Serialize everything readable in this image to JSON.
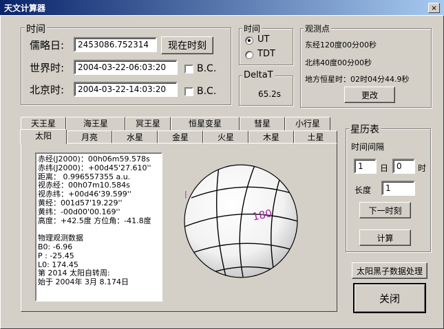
{
  "window": {
    "title": "天文计算器",
    "close_glyph": "×"
  },
  "time_group": {
    "legend": "时间",
    "jd_label": "儒略日:",
    "jd_value": "2453086.752314",
    "now_button": "现在时刻",
    "ut_label": "世界时:",
    "ut_value": "2004-03-22-06:03:20",
    "bj_label": "北京时:",
    "bj_value": "2004-03-22-14:03:20",
    "bc_label": "B.C."
  },
  "timescale_group": {
    "legend": "时间",
    "options": [
      {
        "label": "UT",
        "selected": true
      },
      {
        "label": "TDT",
        "selected": false
      }
    ]
  },
  "deltat_group": {
    "legend": "DeltaT",
    "value": "65.2s"
  },
  "observer_group": {
    "legend": "观测点",
    "longitude": "东经120度00分00秒",
    "latitude": "北纬40度00分00秒",
    "sidereal": "地方恒星时：02时04分44.9秒",
    "change_button": "更改"
  },
  "tabs_row_back": [
    "天王星",
    "海王星",
    "冥王星",
    "恒星变星",
    "彗星",
    "小行星"
  ],
  "tabs_row_front": [
    "太阳",
    "月亮",
    "水星",
    "金星",
    "火星",
    "木星",
    "土星"
  ],
  "active_tab": "太阳",
  "sun_info": [
    "赤经(J2000)：00h06m59.578s",
    "赤纬(J2000)：+00d45'27.610''",
    "距离：  0.996557355 a.u.",
    "视赤经：00h07m10.584s",
    "视赤纬：+00d46'39.599''",
    "黄经：001d57'19.229''",
    "黄纬：-00d00'00.169''",
    "高度：+42.5度 方位角：-41.8度",
    "",
    "物理观测数据",
    "B0: -6.96",
    "P : -25.45",
    "L0: 174.45",
    "第 2014 太阳自转周:",
    "始于 2004年 3月 8.174日"
  ],
  "globe": {
    "label": "180",
    "edge_label": "|",
    "label_color": "#a020a0"
  },
  "ephemeris_group": {
    "legend": "星历表",
    "interval_label": "时间间隔",
    "day_value": "1",
    "day_unit": "日",
    "hour_value": "0",
    "hour_unit": "时",
    "length_label": "长度",
    "length_value": "1",
    "next_button": "下一时刻",
    "compute_button": "计算"
  },
  "sunspot_button": "太阳黑子数据处理",
  "close_button": "关闭"
}
